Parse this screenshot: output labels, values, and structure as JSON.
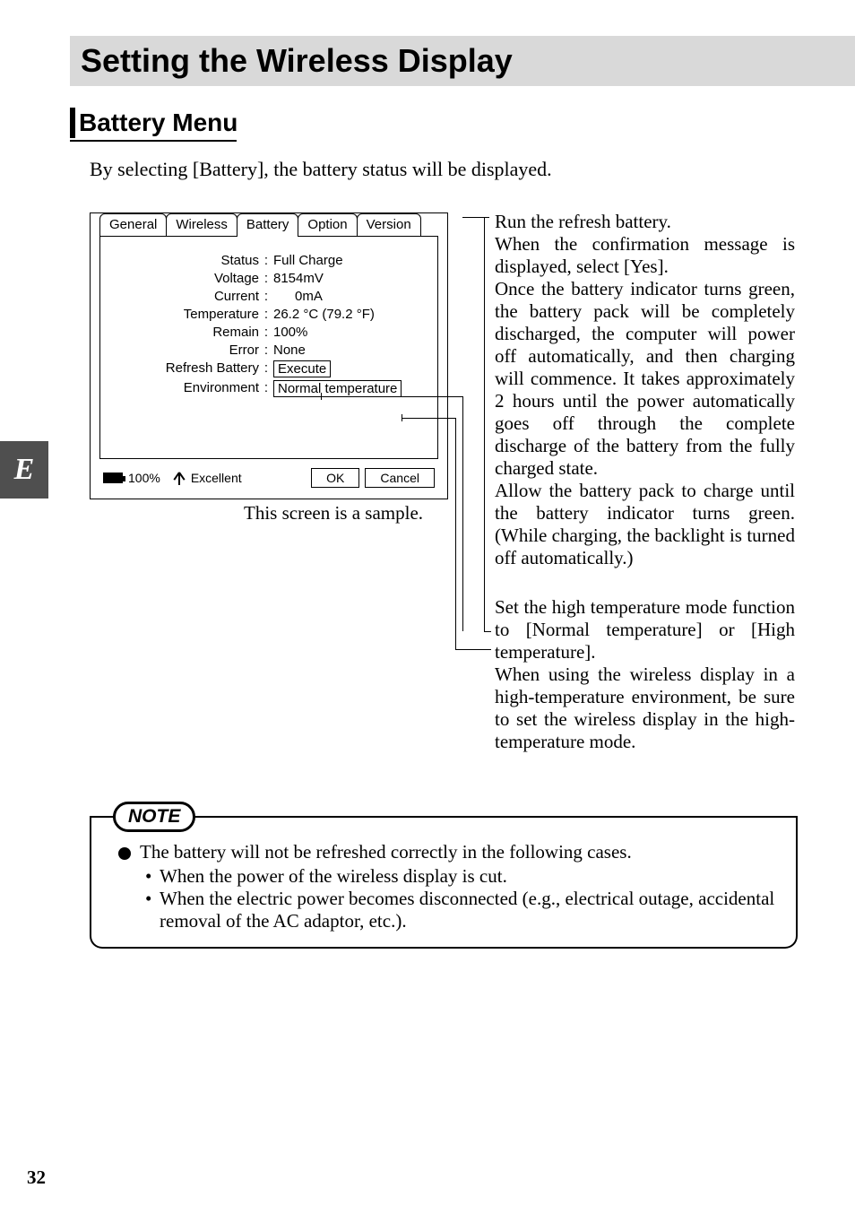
{
  "doc": {
    "title": "Setting the Wireless Display",
    "section": "Battery Menu",
    "intro": "By selecting [Battery], the battery status will be displayed.",
    "side_tab": "E",
    "page_number": "32",
    "caption": "This screen is a sample."
  },
  "dialog": {
    "tabs": {
      "general": "General",
      "wireless": "Wireless",
      "battery": "Battery",
      "option": "Option",
      "version": "Version"
    },
    "fields": {
      "status": {
        "label": "Status",
        "value": "Full Charge"
      },
      "voltage": {
        "label": "Voltage",
        "value": "8154mV"
      },
      "current": {
        "label": "Current",
        "value": "0mA"
      },
      "temperature": {
        "label": "Temperature",
        "value": "26.2 °C (79.2 °F)"
      },
      "remain": {
        "label": "Remain",
        "value": "100%"
      },
      "error": {
        "label": "Error",
        "value": "None"
      },
      "refresh": {
        "label": "Refresh Battery",
        "value": "Execute"
      },
      "environment": {
        "label": "Environment",
        "value": "Normal temperature"
      }
    },
    "status_bar": {
      "battery_pct": "100%",
      "signal": "Excellent",
      "ok": "OK",
      "cancel": "Cancel"
    }
  },
  "annotations": {
    "para1": "Run the refresh battery.\nWhen the confirmation message is displayed, select [Yes].\nOnce the battery indicator turns green, the battery pack will be completely discharged, the computer will power off automatically, and then charging will commence. It takes approximately 2 hours until the power automatically goes off through the complete discharge of the battery from the fully charged state.\nAllow the battery pack to charge until the battery indicator turns green. (While charging, the backlight is turned off automatically.)",
    "para2": "Set the high temperature mode function to [Normal temperature] or [High temperature].\nWhen using the wireless display in a high-temperature environment, be sure to set the wireless display in the high-temperature mode."
  },
  "note": {
    "label": "NOTE",
    "lead": "The battery will not be refreshed correctly in the following cases.",
    "items": [
      "When the power of the wireless display is cut.",
      "When the electric power becomes disconnected (e.g., electrical outage, accidental removal of the AC adaptor, etc.)."
    ]
  }
}
